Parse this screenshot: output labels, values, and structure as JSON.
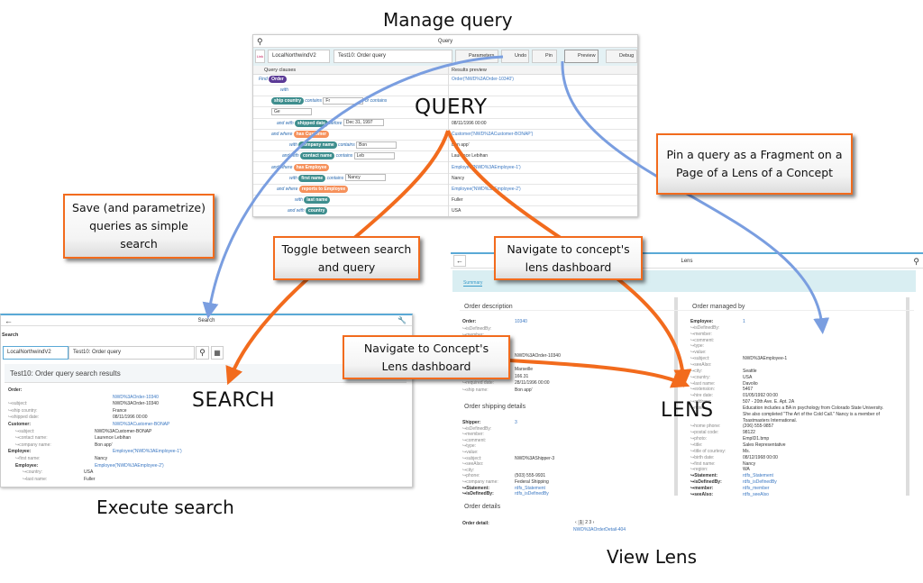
{
  "captions": {
    "manage_query": "Manage query",
    "execute_search": "Execute search",
    "view_lens": "View Lens",
    "query": "QUERY",
    "search": "SEARCH",
    "lens": "LENS"
  },
  "callouts": {
    "pin": "Pin a query as a Fragment on a Page of a Lens of a Concept",
    "save": "Save (and parametrize) queries as simple search",
    "toggle": "Toggle between search and query",
    "nav_lens": "Navigate to concept's lens dashboard",
    "nav_concept": "Navigate to Concept's Lens dashboard"
  },
  "colors": {
    "orange_arrow": "#f26b1d",
    "blue_arrow": "#7a9ee0"
  },
  "query": {
    "title": "Query",
    "link": "Link",
    "dataset": "LocalNorthwindV2",
    "query_name": "Test10: Order query",
    "buttons": {
      "parameters": "Parameters",
      "undo": "Undo",
      "pin": "Pin",
      "preview": "Preview",
      "debug": "Debug"
    },
    "col_clauses": "Query clauses",
    "col_results": "Results preview",
    "rows": [
      {
        "html": "<span class='kw'>Find</span> <span class='chip purple'>Order</span>",
        "res": "Order('NWD%3AOrder-10340')",
        "link": true,
        "indent": 6
      },
      {
        "html": "<span class='kw'>with</span>",
        "res": "",
        "indent": 30
      },
      {
        "html": "<span class='chip teal'>ship country</span> <span class='kw'>contains</span> <span class='inp'>Fr</span> <span class='kw'>or contains</span>",
        "res": "",
        "indent": 20
      },
      {
        "html": "<span class='inp'>Ge</span>",
        "res": "",
        "indent": 20
      },
      {
        "html": "<span class='kw'>and with</span> <span class='chip teal'>shipped date</span> <span class='kw'>before</span> <span class='inp'>Dec 31, 1997</span>",
        "res": "08/11/1996 00:00",
        "indent": 26
      },
      {
        "html": "<span class='kw'>and where</span> <span class='chip orange'>has Customer</span>",
        "res": "Customer('NWD%3ACustomer-BONAP')",
        "link": true,
        "indent": 20
      },
      {
        "html": "<span class='kw'>with</span> <span class='chip teal'>company name</span> <span class='kw'>contains</span> <span class='inp'>Bon</span>",
        "res": "Bon app'",
        "indent": 40
      },
      {
        "html": "<span class='kw'>and with</span> <span class='chip teal'>contact name</span> <span class='kw'>contains</span> <span class='inp'>Leb</span>",
        "res": "Laurence Lebihan",
        "indent": 32
      },
      {
        "html": "<span class='kw'>and where</span> <span class='chip orange'>has Employee</span>",
        "res": "Employee('NWD%3AEmployee-1')",
        "link": true,
        "indent": 20
      },
      {
        "html": "<span class='kw'>with</span> <span class='chip teal'>first name</span> <span class='kw'>contains</span> <span class='inp'>Nancy</span>",
        "res": "Nancy",
        "indent": 40
      },
      {
        "html": "<span class='kw'>and where</span> <span class='chip orange'>reports to Employee</span>",
        "res": "Employee('NWD%3AEmployee-2')",
        "link": true,
        "indent": 26
      },
      {
        "html": "<span class='kw'>with</span> <span class='chip teal'>last name</span>",
        "res": "Fuller",
        "indent": 46
      },
      {
        "html": "<span class='kw'>and with</span> <span class='chip teal'>country</span>",
        "res": "USA",
        "indent": 38
      }
    ]
  },
  "search": {
    "title": "Search",
    "section": "Search",
    "dataset": "LocalNorthwindV2",
    "query_name": "Test10: Order query",
    "results_title": "Test10: Order query search results",
    "rows": [
      {
        "k": "Order:",
        "v": "",
        "b": true,
        "i": 0
      },
      {
        "k": "",
        "v": "NWD%3AOrder-10340",
        "l": true,
        "i": 0
      },
      {
        "k": "↪subject:",
        "v": "NWD%3AOrder-10340",
        "i": 0
      },
      {
        "k": "↪ship country:",
        "v": "France",
        "i": 0
      },
      {
        "k": "↪shipped date:",
        "v": "08/11/1996 00:00",
        "i": 0
      },
      {
        "k": "Customer:",
        "v": "NWD%3ACustomer-BONAP",
        "l": true,
        "b": true,
        "i": 0
      },
      {
        "k": "↪subject:",
        "v": "NWD%3ACustomer-BONAP",
        "i": 1
      },
      {
        "k": "↪contact name:",
        "v": "Laurence Lebihan",
        "i": 1
      },
      {
        "k": "↪company name:",
        "v": "Bon app'",
        "i": 1
      },
      {
        "k": "Employee:",
        "v": "Employee('NWD%3AEmployee-1')",
        "l": true,
        "b": true,
        "i": 0
      },
      {
        "k": "↪first name:",
        "v": "Nancy",
        "i": 1
      },
      {
        "k": "Employee:",
        "v": "Employee('NWD%3AEmployee-2')",
        "l": true,
        "b": true,
        "i": 1
      },
      {
        "k": "↪country:",
        "v": "USA",
        "i": 2
      },
      {
        "k": "↪last name:",
        "v": "Fuller",
        "i": 2
      }
    ]
  },
  "lens": {
    "title": "Lens",
    "tab": "Summary",
    "order_description": {
      "title": "Order description",
      "rows": [
        {
          "k": "Order:",
          "v": "10340",
          "l": true,
          "b": true
        },
        {
          "k": "↪isDefinedBy:",
          "v": ""
        },
        {
          "k": "↪member:",
          "v": ""
        },
        {
          "k": "",
          "v": ""
        },
        {
          "k": "",
          "v": ""
        },
        {
          "k": "",
          "v": "NWD%3AOrder-10340"
        },
        {
          "k": "",
          "v": ""
        },
        {
          "k": "",
          "v": "Marseille"
        },
        {
          "k": "",
          "v": "166.31"
        },
        {
          "k": "↪required date:",
          "v": "28/11/1996 00:00"
        },
        {
          "k": "↪ship name:",
          "v": "Bon app'"
        }
      ]
    },
    "order_shipping": {
      "title": "Order shipping details",
      "rows": [
        {
          "k": "Shipper:",
          "v": "3",
          "l": true,
          "b": true
        },
        {
          "k": "↪isDefinedBy:",
          "v": ""
        },
        {
          "k": "↪member:",
          "v": ""
        },
        {
          "k": "↪comment:",
          "v": ""
        },
        {
          "k": "↪type:",
          "v": ""
        },
        {
          "k": "↪value:",
          "v": ""
        },
        {
          "k": "↪subject:",
          "v": "NWD%3AShipper-3"
        },
        {
          "k": "↪seeAlso:",
          "v": ""
        },
        {
          "k": "↪city:",
          "v": ""
        },
        {
          "k": "↪phone:",
          "v": "(503) 555-9931"
        },
        {
          "k": "↪company name:",
          "v": "Federal Shipping"
        },
        {
          "k": "↪Statement:",
          "v": "rdfs_Statement",
          "l": true,
          "b": true
        },
        {
          "k": "↪isDefinedBy:",
          "v": "rdfs_isDefinedBy",
          "l": true,
          "b": true
        }
      ]
    },
    "order_managed": {
      "title": "Order managed by",
      "rows": [
        {
          "k": "Employee:",
          "v": "1",
          "l": true,
          "b": true
        },
        {
          "k": "↪isDefinedBy:",
          "v": ""
        },
        {
          "k": "↪member:",
          "v": ""
        },
        {
          "k": "↪comment:",
          "v": ""
        },
        {
          "k": "↪type:",
          "v": ""
        },
        {
          "k": "↪value:",
          "v": ""
        },
        {
          "k": "↪subject:",
          "v": "NWD%3AEmployee-1"
        },
        {
          "k": "↪seeAlso:",
          "v": ""
        },
        {
          "k": "↪city:",
          "v": "Seattle"
        },
        {
          "k": "↪country:",
          "v": "USA"
        },
        {
          "k": "↪last name:",
          "v": "Davolio"
        },
        {
          "k": "↪extension:",
          "v": "5467"
        },
        {
          "k": "↪hire date:",
          "v": "01/05/1992 00:00"
        },
        {
          "k": "↪address:",
          "v": "507 - 20th Ave. E. Apt. 2A"
        },
        {
          "k": "↪notes:",
          "v": "Education includes a BA in psychology from Colorado State University."
        },
        {
          "k": "",
          "v": "She also completed \"The Art of the Cold Call.\" Nancy is a member of"
        },
        {
          "k": "",
          "v": "Toastmasters International."
        },
        {
          "k": "↪home phone:",
          "v": "(206) 555-9857"
        },
        {
          "k": "↪postal code:",
          "v": "98122"
        },
        {
          "k": "↪photo:",
          "v": "EmpID1.bmp"
        },
        {
          "k": "↪title:",
          "v": "Sales Representative"
        },
        {
          "k": "↪title of courtesy:",
          "v": "Ms."
        },
        {
          "k": "↪birth date:",
          "v": "08/12/1968 00:00"
        },
        {
          "k": "↪first name:",
          "v": "Nancy"
        },
        {
          "k": "↪region:",
          "v": "WA"
        },
        {
          "k": "↪Statement:",
          "v": "rdfs_Statement",
          "l": true,
          "b": true
        },
        {
          "k": "↪isDefinedBy:",
          "v": "rdfs_isDefinedBy",
          "l": true,
          "b": true
        },
        {
          "k": "↪member:",
          "v": "rdfs_member",
          "l": true,
          "b": true
        },
        {
          "k": "↪seeAlso:",
          "v": "rdfs_seeAlso",
          "l": true,
          "b": true
        }
      ]
    },
    "order_details": {
      "title": "Order details",
      "label": "Order detail:",
      "pages": [
        "1",
        "2",
        "3"
      ],
      "link": "NWD%3AOrderDetail-404"
    }
  }
}
